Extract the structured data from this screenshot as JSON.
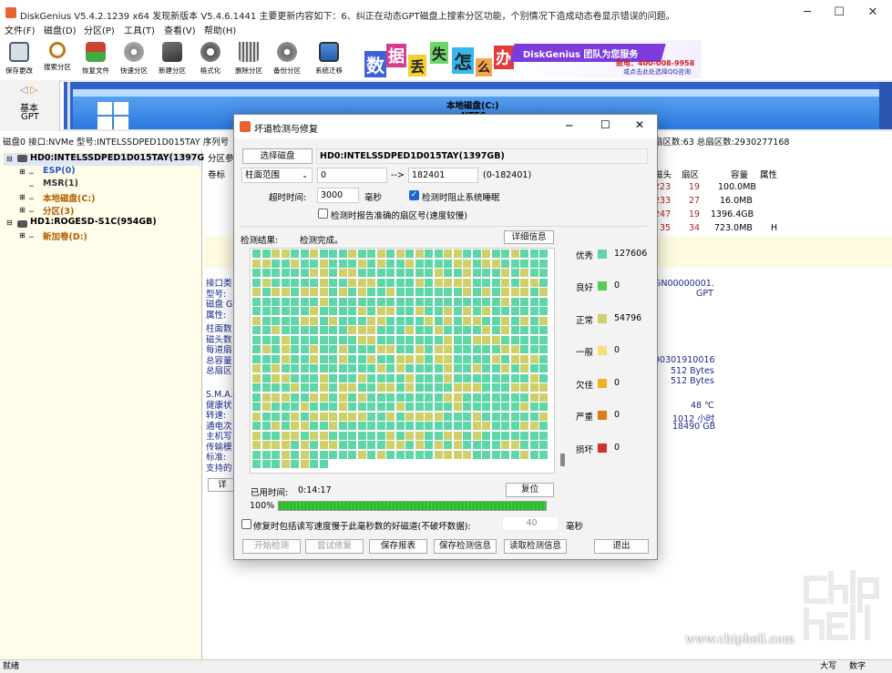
{
  "window": {
    "title": "DiskGenius V5.4.2.1239 x64    发现新版本 V5.4.6.1441    主要更新内容如下：6、纠正在动态GPT磁盘上搜索分区功能，个别情况下造成动态卷显示错误的问题。"
  },
  "menu": [
    "文件(F)",
    "磁盘(D)",
    "分区(P)",
    "工具(T)",
    "查看(V)",
    "帮助(H)"
  ],
  "toolbar": [
    {
      "label": "保存更改",
      "icon": "save-disk-icon"
    },
    {
      "label": "搜索分区",
      "icon": "magnifier-icon"
    },
    {
      "label": "恢复文件",
      "icon": "recover-files-icon"
    },
    {
      "label": "快速分区",
      "icon": "quick-partition-icon"
    },
    {
      "label": "新建分区",
      "icon": "new-partition-icon"
    },
    {
      "label": "格式化",
      "icon": "format-icon"
    },
    {
      "label": "删除分区",
      "icon": "trash-icon"
    },
    {
      "label": "备份分区",
      "icon": "backup-icon"
    },
    {
      "label": "系统迁移",
      "icon": "migrate-icon"
    }
  ],
  "ad": {
    "chars": [
      "数",
      "据",
      "丢",
      "失",
      "怎",
      "么",
      "办"
    ],
    "slogan": "DiskGenius 团队为您服务",
    "phone": "致电：400-008-9958",
    "qq": "或点击此处选择QQ咨询"
  },
  "disk_map": {
    "basic": "基本",
    "gpt": "GPT",
    "partition_name": "本地磁盘(C:)",
    "fs": "NTFS"
  },
  "info_line": "磁盘0 接口:NVMe   型号:INTELSSDPED1D015TAY   序列号",
  "info_line_right": "扇区数:63  总扇区数:2930277168",
  "tree": [
    {
      "label": "HD0:INTELSSDPED1D015TAY(1397GB)",
      "color": "#000"
    },
    {
      "label": "ESP(0)",
      "color": "#2a55c8"
    },
    {
      "label": "MSR(1)",
      "color": "#333"
    },
    {
      "label": "本地磁盘(C:)",
      "color": "#b35e00"
    },
    {
      "label": "分区(3)",
      "color": "#b35e00"
    },
    {
      "label": "HD1:ROGESD-S1C(954GB)",
      "color": "#000"
    },
    {
      "label": "新加卷(D:)",
      "color": "#b35e00"
    }
  ],
  "right_table": {
    "tab": "分区参",
    "col0": "卷标",
    "headers": [
      "磁头",
      "扇区",
      "容量",
      "属性"
    ],
    "rows": [
      [
        "223",
        "19",
        "100.0MB",
        ""
      ],
      [
        "233",
        "27",
        "16.0MB",
        ""
      ],
      [
        "247",
        "19",
        "1396.4GB",
        ""
      ],
      [
        "35",
        "34",
        "723.0MB",
        "H"
      ]
    ]
  },
  "right_details": {
    "labels_a": [
      "接口类",
      "型号:",
      "磁盘 G",
      "属性:"
    ],
    "labels_b": [
      "柱面数",
      "磁头数",
      "每道扇",
      "总容量",
      "总扇区"
    ],
    "labels_c": [
      "S.M.A.",
      "健康状",
      "转速:",
      "通电次",
      "主机写",
      "传输模",
      "标准:",
      "支持的"
    ],
    "serial": "GN00000001.",
    "gpt": "GPT",
    "sn2": "00301910016",
    "bytes1": "512 Bytes",
    "bytes2": "512 Bytes",
    "temp": "48 ℃",
    "hours": "1012 小时",
    "written": "18490 GB",
    "detail_btn": "详"
  },
  "dialog": {
    "title": "坏道检测与修复",
    "select_disk": "选择磁盘",
    "disk_name": "HD0:INTELSSDPED1D015TAY(1397GB)",
    "range_select": "柱面范围",
    "range_from": "0",
    "arrow": "-->",
    "range_to": "182401",
    "range_hint": "(0-182401)",
    "timeout_label": "超时时间:",
    "timeout_value": "3000",
    "ms": "毫秒",
    "prevent_sleep": "检测时阻止系统睡眠",
    "prevent_sleep_checked": true,
    "report_sector": "检测时报告准确的扇区号(速度较慢)",
    "result_label": "检测结果:",
    "result_status": "检测完成。",
    "detail_btn": "详细信息",
    "legend": [
      {
        "label": "优秀",
        "color": "#5fd6a8",
        "count": "127606"
      },
      {
        "label": "良好",
        "color": "#55cc55",
        "count": "0"
      },
      {
        "label": "正常",
        "color": "#cfd06a",
        "count": "54796"
      },
      {
        "label": "一般",
        "color": "#f2e07a",
        "count": "0"
      },
      {
        "label": "欠佳",
        "color": "#f0b020",
        "count": "0"
      },
      {
        "label": "严重",
        "color": "#e07a1a",
        "count": "0"
      },
      {
        "label": "损坏",
        "color": "#d03030",
        "count": "0"
      }
    ],
    "elapsed_label": "已用时间:",
    "elapsed": "0:14:17",
    "reset_btn": "复位",
    "percent": "100%",
    "progress": 1.0,
    "repair_option": "修复时包括读写速度慢于此毫秒数的好磁道(不破坏数据):",
    "repair_ms": "40",
    "repair_unit": "毫秒",
    "buttons": [
      "开始检测",
      "尝试修复",
      "保存报表",
      "保存检测信息",
      "读取检测信息",
      "退出"
    ]
  },
  "status": {
    "left": "就绪",
    "caps": "大写",
    "num": "数字"
  },
  "watermark": {
    "text": "www.chiphell.com"
  }
}
